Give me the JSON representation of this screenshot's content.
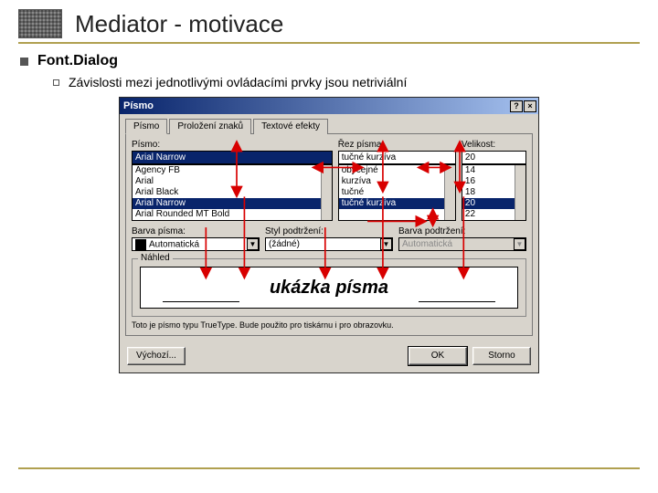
{
  "header": {
    "title": "Mediator - motivace"
  },
  "bullets": {
    "level1": "Font.Dialog",
    "level2": "Závislosti mezi jednotlivými ovládacími prvky jsou netriviální"
  },
  "dialog": {
    "title": "Písmo",
    "tabs": [
      "Písmo",
      "Proložení znaků",
      "Textové efekty"
    ],
    "fontLabel": "Písmo:",
    "fontValue": "Arial Narrow",
    "fontList": [
      "Agency FB",
      "Arial",
      "Arial Black",
      "Arial Narrow",
      "Arial Rounded MT Bold"
    ],
    "styleLabel": "Řez písma:",
    "styleValue": "tučné kurzíva",
    "styleList": [
      "obyčejné",
      "kurzíva",
      "tučné",
      "tučné kurzíva"
    ],
    "sizeLabel": "Velikost:",
    "sizeValue": "20",
    "sizeList": [
      "14",
      "16",
      "18",
      "20",
      "22"
    ],
    "colorLabel": "Barva písma:",
    "colorValue": "Automatická",
    "underlineLabel": "Styl podtržení:",
    "underlineValue": "(žádné)",
    "underlineColorLabel": "Barva podtržení:",
    "underlineColorValue": "Automatická",
    "previewLabel": "Náhled",
    "previewText": "ukázka písma",
    "hint": "Toto je písmo typu TrueType. Bude použito pro tiskárnu i pro obrazovku.",
    "buttons": {
      "default": "Výchozí...",
      "ok": "OK",
      "cancel": "Storno"
    }
  },
  "arrowColor": "#d80000"
}
